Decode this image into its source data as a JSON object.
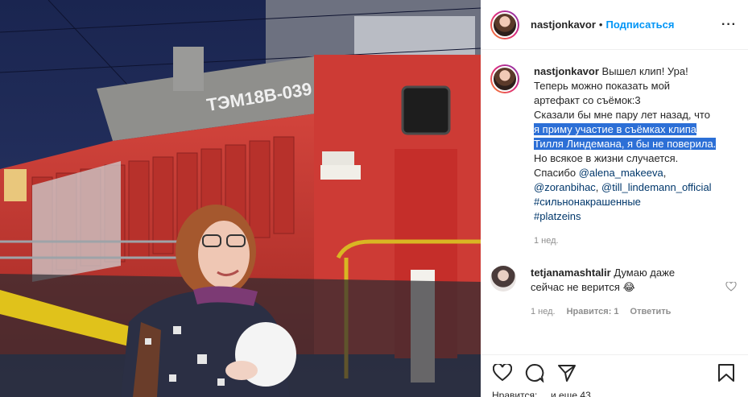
{
  "colors": {
    "accent": "#0095f6",
    "link": "#00376b",
    "highlight": "#2c6fd6",
    "locomotive": "#c83a34",
    "sky": "#1d2a52"
  },
  "photo": {
    "loco_label": "ТЭМ18В-039",
    "alt": "photo"
  },
  "header": {
    "username": "nastjonkavor",
    "separator": "•",
    "follow_label": "Подписаться",
    "more_icon": "more-horizontal-icon",
    "more_glyph": "···"
  },
  "caption": {
    "username": "nastjonkavor",
    "line1": "Вышел клип! Ура!",
    "line2": "Теперь можно показать мой",
    "line3": "артефакт со съёмок:3",
    "line4": "Сказали бы мне пару лет назад, что",
    "line5_highlight": "я приму участие в съёмках клипа",
    "line6_highlight": "Тилля Линдемана, я бы не поверила.",
    "line7": "Но всякое в жизни случается.",
    "line8_prefix": "Спасибо",
    "mention1": "@alena_makeeva",
    "mention2": "@zoranbihac",
    "mention3": "@till_lindemann_official",
    "hashtag1": "#сильнонакрашенные",
    "hashtag2": "#platzeins",
    "time": "1 нед."
  },
  "reply": {
    "username": "tetjanamashtalir",
    "text_1": "Думаю даже",
    "text_2": "сейчас не верится",
    "emoji": "😂",
    "time": "1 нед.",
    "likes": "Нравится: 1",
    "reply_label": "Ответить"
  },
  "actions": {
    "like_icon": "heart-icon",
    "comment_icon": "comment-icon",
    "share_icon": "share-icon",
    "save_icon": "bookmark-icon"
  },
  "peek": {
    "text": "Нравится: ... и еще 43"
  }
}
